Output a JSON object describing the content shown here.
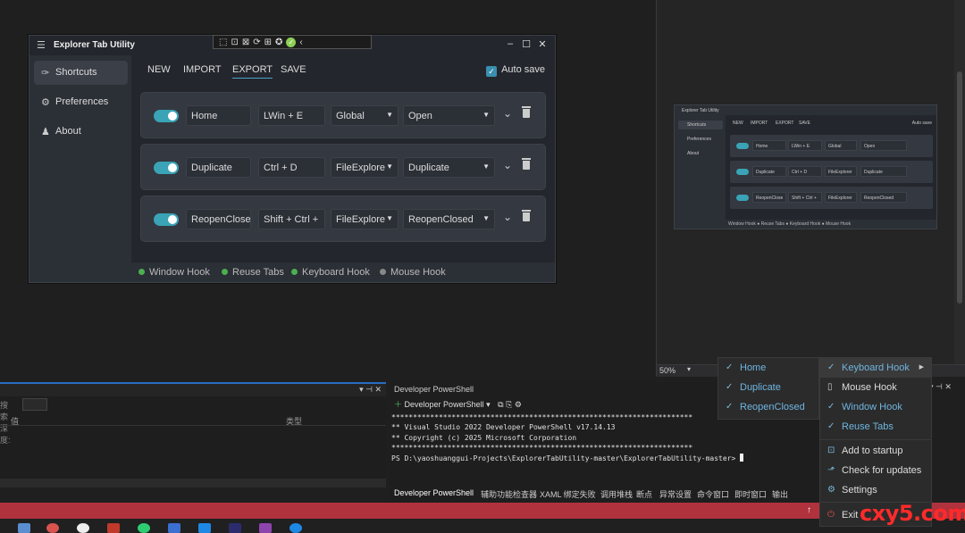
{
  "designer": {
    "zoom": "50%"
  },
  "app": {
    "title": "Explorer Tab Utility",
    "sidebar": [
      {
        "label": "Shortcuts",
        "icon": "pin-icon",
        "glyph": "✑"
      },
      {
        "label": "Preferences",
        "icon": "gear-icon",
        "glyph": "⚙"
      },
      {
        "label": "About",
        "icon": "people-icon",
        "glyph": "♟"
      }
    ],
    "tabs": [
      "NEW",
      "IMPORT",
      "EXPORT",
      "SAVE"
    ],
    "autosave_label": "Auto save",
    "shortcuts": [
      {
        "name": "Home",
        "keys": "LWin + E",
        "scope": "Global",
        "action": "Open"
      },
      {
        "name": "Duplicate",
        "keys": "Ctrl + D",
        "scope": "FileExplore",
        "action": "Duplicate"
      },
      {
        "name": "ReopenClose",
        "keys": "Shift + Ctrl +",
        "scope": "FileExplore",
        "action": "ReopenClosed"
      }
    ],
    "status": [
      {
        "label": "Window Hook",
        "color": "#4caf50"
      },
      {
        "label": "Reuse Tabs",
        "color": "#4caf50"
      },
      {
        "label": "Keyboard Hook",
        "color": "#4caf50"
      },
      {
        "label": "Mouse Hook",
        "color": "#888888"
      }
    ]
  },
  "mini": {
    "title": "Explorer Tab Utility",
    "sidebar": [
      "Shortcuts",
      "Preferences",
      "About"
    ],
    "tabs": [
      "NEW",
      "IMPORT",
      "EXPORT",
      "SAVE"
    ],
    "autosave": "Auto save",
    "rows": [
      {
        "name": "Home",
        "keys": "LWin + E",
        "scope": "Global",
        "action": "Open"
      },
      {
        "name": "Duplicate",
        "keys": "Ctrl + D",
        "scope": "FileExplorer",
        "action": "Duplicate"
      },
      {
        "name": "ReopenClose",
        "keys": "Shift + Ctrl +",
        "scope": "FileExplorer",
        "action": "ReopenClosed"
      }
    ],
    "status": "Window Hook  ● Reuse Tabs  ● Keyboard Hook  ● Mouse Hook"
  },
  "leftpanel": {
    "col2": "类型",
    "col1": "值",
    "label": "搜索深度:"
  },
  "terminal": {
    "header": "Developer PowerShell",
    "toolbar_label": "Developer PowerShell",
    "lines": [
      "**********************************************************************",
      "** Visual Studio 2022 Developer PowerShell v17.14.13",
      "** Copyright (c) 2025 Microsoft Corporation",
      "**********************************************************************",
      "PS D:\\yaoshuanggui-Projects\\ExplorerTabUtility-master\\ExplorerTabUtility-master> "
    ],
    "tabs": [
      "Developer PowerShell",
      "辅助功能检查器",
      "XAML 绑定失败",
      "调用堆栈",
      "断点",
      "异常设置",
      "命令窗口",
      "即时窗口",
      "输出"
    ]
  },
  "tray_left": [
    "Home",
    "Duplicate",
    "ReopenClosed"
  ],
  "tray_right": {
    "hooks": [
      {
        "label": "Keyboard Hook",
        "mark": "✓",
        "submenu": true
      },
      {
        "label": "Mouse Hook",
        "mark": "▯"
      },
      {
        "label": "Window Hook",
        "mark": "✓"
      },
      {
        "label": "Reuse Tabs",
        "mark": "✓"
      }
    ],
    "actions": [
      {
        "label": "Add to startup",
        "mark": "⊡"
      },
      {
        "label": "Check for updates",
        "mark": "⬏"
      },
      {
        "label": "Settings",
        "mark": "⚙"
      },
      {
        "label": "Exit",
        "mark": "⏻"
      }
    ]
  },
  "watermark": "cxy5.com"
}
